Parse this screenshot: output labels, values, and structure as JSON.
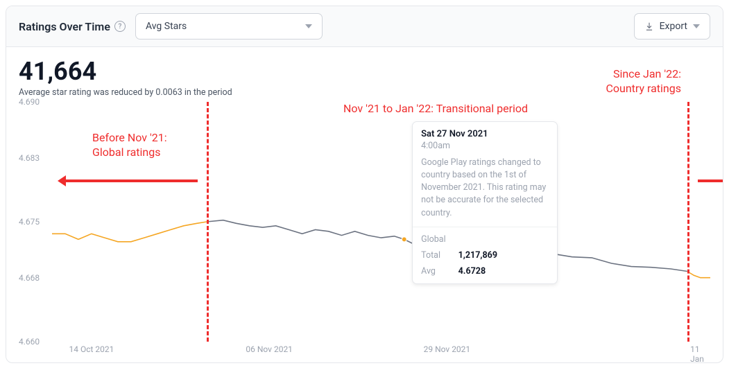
{
  "header": {
    "title": "Ratings Over Time",
    "metric_select": "Avg Stars",
    "export_label": "Export"
  },
  "summary": {
    "big_number": "41,664",
    "subtext": "Average star rating was reduced by 0.0063 in the period"
  },
  "annotations": {
    "before": {
      "l1": "Before Nov '21:",
      "l2": "Global ratings"
    },
    "middle": "Nov '21 to Jan '22: Transitional period",
    "after": {
      "l1": "Since Jan '22:",
      "l2": "Country ratings"
    }
  },
  "tooltip": {
    "date": "Sat 27 Nov 2021",
    "time": "4:00am",
    "message": "Google Play ratings changed to country based on the 1st of November 2021. This rating may not be accurate for the selected country.",
    "global_label": "Global",
    "total_label": "Total",
    "avg_label": "Avg",
    "total_value": "1,217,869",
    "avg_value": "4.6728"
  },
  "chart_data": {
    "type": "line",
    "title": "Ratings Over Time",
    "ylabel": "Avg Stars",
    "xlabel": "",
    "ylim": [
      4.66,
      4.69
    ],
    "y_ticks": [
      4.69,
      4.683,
      4.675,
      4.668,
      4.66
    ],
    "x_ticks": [
      "14 Oct 2021",
      "06 Nov 2021",
      "29 Nov 2021",
      "11 Jan"
    ],
    "x_tick_positions": [
      0.06,
      0.33,
      0.6,
      0.98
    ],
    "vlines": [
      0.235,
      0.965
    ],
    "marker_x": 0.535,
    "series": [
      {
        "name": "Before Nov '21 (orange)",
        "color": "#f5a623",
        "x": [
          0.0,
          0.02,
          0.04,
          0.06,
          0.08,
          0.1,
          0.12,
          0.14,
          0.16,
          0.18,
          0.2,
          0.22,
          0.235
        ],
        "y": [
          4.6735,
          4.6735,
          4.6728,
          4.6735,
          4.673,
          4.6725,
          4.6725,
          4.673,
          4.6735,
          4.674,
          4.6745,
          4.6748,
          4.675
        ]
      },
      {
        "name": "Transitional (grey)",
        "color": "#6b7280",
        "x": [
          0.235,
          0.26,
          0.28,
          0.3,
          0.32,
          0.34,
          0.36,
          0.38,
          0.4,
          0.42,
          0.44,
          0.46,
          0.48,
          0.5,
          0.52,
          0.535,
          0.55,
          0.58,
          0.61,
          0.64,
          0.67,
          0.7,
          0.73,
          0.76,
          0.79,
          0.82,
          0.85,
          0.88,
          0.91,
          0.94,
          0.965
        ],
        "y": [
          4.675,
          4.6752,
          4.6748,
          4.6745,
          4.6743,
          4.6745,
          4.674,
          4.6735,
          4.674,
          4.6738,
          4.6733,
          4.6738,
          4.6733,
          4.673,
          4.6732,
          4.6728,
          4.6722,
          4.672,
          4.672,
          4.6718,
          4.6716,
          4.6714,
          4.671,
          4.671,
          4.6706,
          4.6705,
          4.6698,
          4.6694,
          4.6693,
          4.6691,
          4.6688
        ]
      },
      {
        "name": "Since Jan '22 (orange)",
        "color": "#f5a623",
        "x": [
          0.965,
          0.975,
          0.985,
          1.0
        ],
        "y": [
          4.6688,
          4.6683,
          4.668,
          4.668
        ]
      }
    ]
  }
}
